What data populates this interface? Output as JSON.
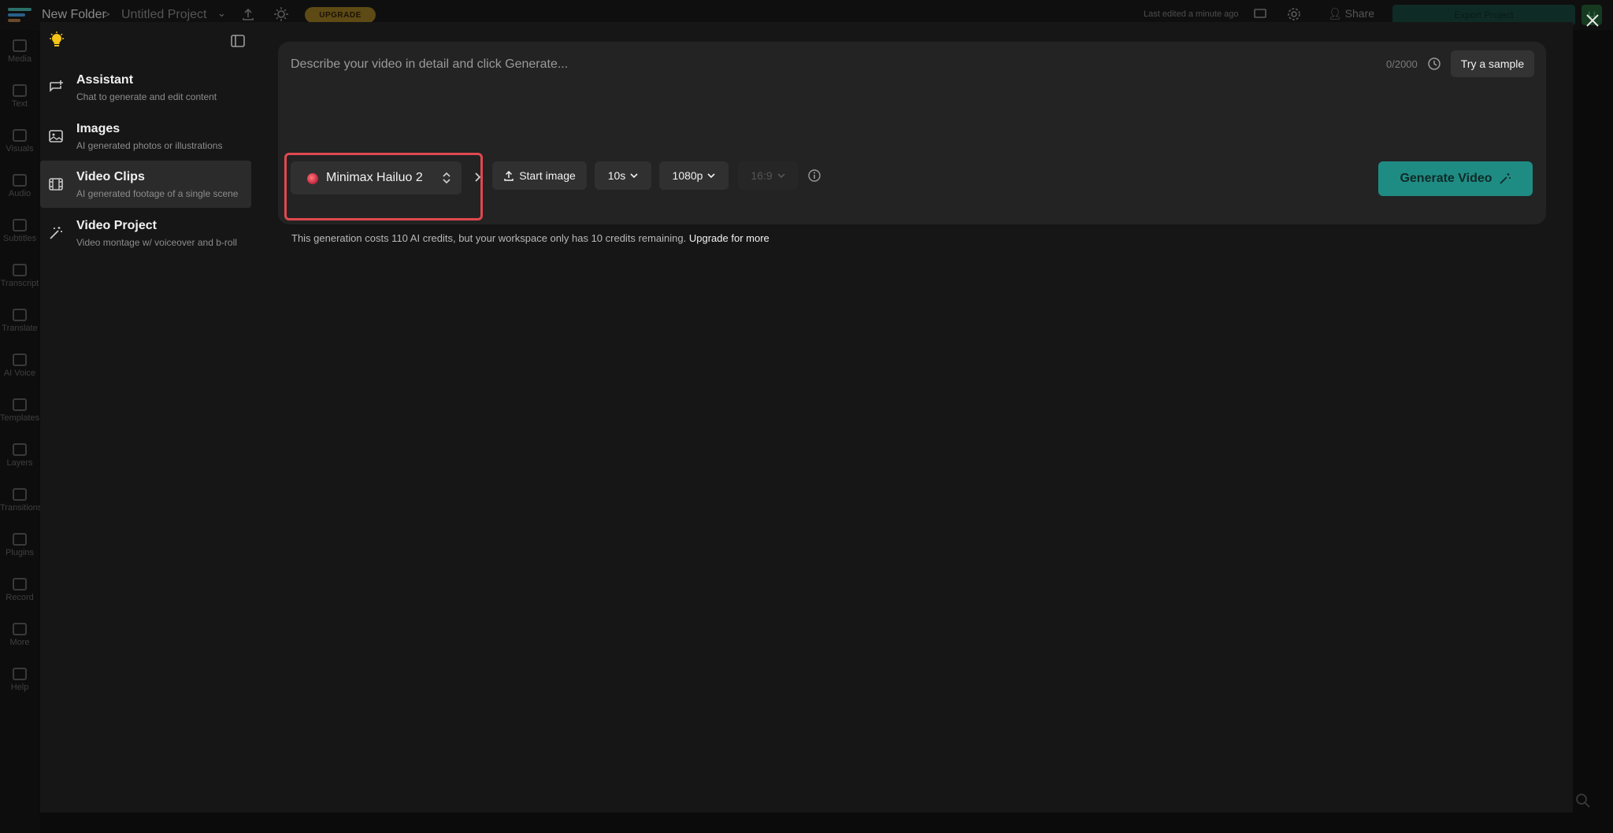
{
  "topbar": {
    "folder": "New Folder",
    "separator": ">",
    "project": "Untitled Project",
    "upgrade": "UPGRADE",
    "last_edited": "Last edited a minute ago",
    "share": "Share",
    "export": "Export Project",
    "avatar": "LI"
  },
  "rail": {
    "items": [
      "Media",
      "Text",
      "Visuals",
      "Audio",
      "Subtitles",
      "Transcript",
      "Translate",
      "AI Voice",
      "Templates",
      "Layers",
      "Transitions",
      "Plugins",
      "Record",
      "More",
      "Help"
    ]
  },
  "sidebar": {
    "items": [
      {
        "title": "Assistant",
        "subtitle": "Chat to generate and edit content",
        "icon": "chat-plus-icon"
      },
      {
        "title": "Images",
        "subtitle": "AI generated photos or illustrations",
        "icon": "image-icon"
      },
      {
        "title": "Video Clips",
        "subtitle": "AI generated footage of a single scene",
        "icon": "film-icon"
      },
      {
        "title": "Video Project",
        "subtitle": "Video montage w/ voiceover and b-roll",
        "icon": "magic-wand-icon"
      }
    ]
  },
  "prompt": {
    "placeholder": "Describe your video in detail and click Generate...",
    "char_count": "0/2000",
    "sample": "Try a sample"
  },
  "controls": {
    "model": "Minimax Hailuo 2",
    "start_image": "Start image",
    "duration": "10s",
    "resolution": "1080p",
    "aspect": "16:9",
    "generate": "Generate Video"
  },
  "credits": {
    "message": "This generation costs 110 AI credits, but your workspace only has 10 credits remaining.",
    "link": "Upgrade for more"
  },
  "colors": {
    "accent": "#1f8c84",
    "highlight": "#e0484f",
    "panel": "#161616",
    "box": "#232323"
  }
}
